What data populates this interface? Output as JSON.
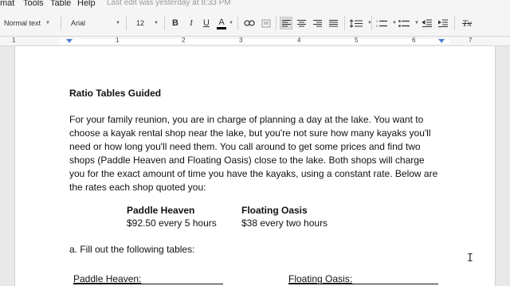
{
  "menu": [
    "mat",
    "Tools",
    "Table",
    "Help"
  ],
  "last_edit": "Last edit was yesterday at 8:33 PM",
  "toolbar": {
    "style": "Normal text",
    "font": "Arial",
    "size": "12",
    "bold": "B",
    "italic": "I",
    "underline": "U",
    "text_color": "A",
    "clear_format": "Tx"
  },
  "ruler": {
    "marks": [
      "1",
      "1",
      "2",
      "3",
      "4",
      "5",
      "6",
      "7"
    ]
  },
  "document": {
    "title": "Ratio Tables Guided",
    "paragraph_lines": [
      "For your family reunion, you are in charge of planning a day at the lake. You want to",
      "choose a kayak rental shop near the lake, but you're not sure how many kayaks you'll",
      "need or how long you'll need them. You call around to get some prices and find two",
      "shops (Paddle Heaven and Floating Oasis) close to the lake. Both shops will charge",
      "you for the exact amount of time you have the kayaks, using a constant rate. Below are",
      "the rates each shop quoted you:"
    ],
    "shops": [
      {
        "name": "Paddle Heaven",
        "rate": "$92.50 every 5 hours"
      },
      {
        "name": "Floating Oasis",
        "rate": "$38 every two hours"
      }
    ],
    "question_a": "a.   Fill out the following tables:",
    "table_headers": [
      "Paddle Heaven:",
      "Floating Oasis:"
    ]
  }
}
